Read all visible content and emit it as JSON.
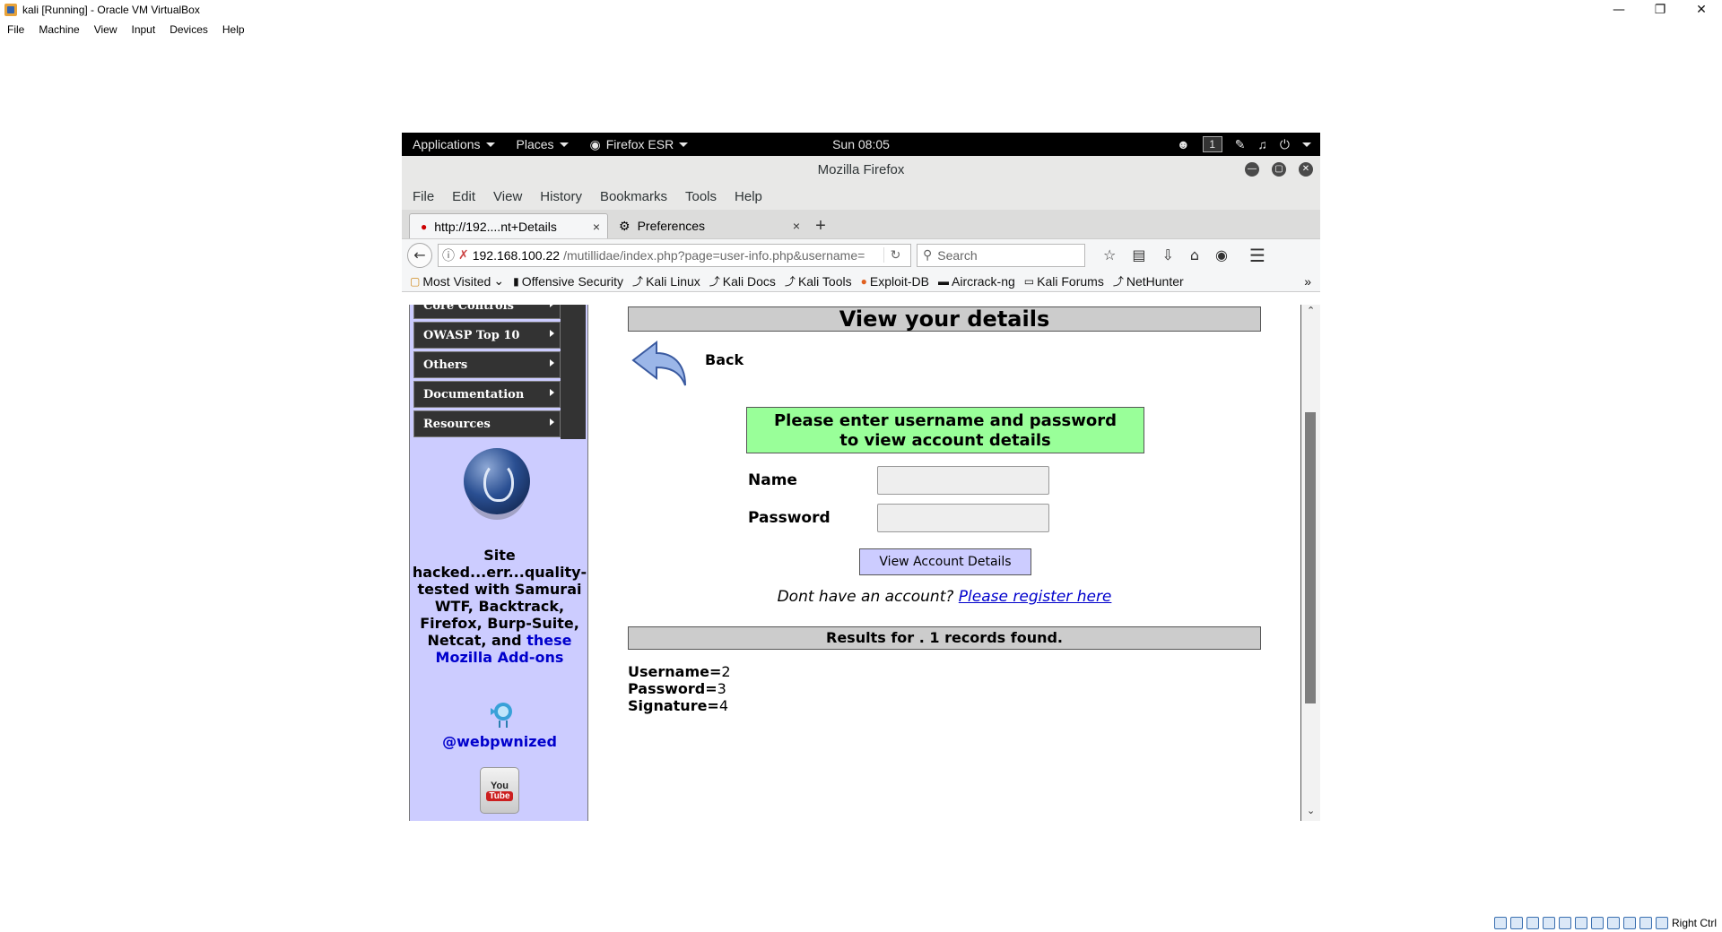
{
  "virtualbox": {
    "title": "kali [Running] - Oracle VM VirtualBox",
    "menu": [
      "File",
      "Machine",
      "View",
      "Input",
      "Devices",
      "Help"
    ],
    "host_key": "Right Ctrl"
  },
  "gnome": {
    "applications": "Applications",
    "places": "Places",
    "firefox": "Firefox ESR",
    "clock": "Sun 08:05",
    "workspace": "1"
  },
  "firefox": {
    "window_title": "Mozilla Firefox",
    "menu": [
      "File",
      "Edit",
      "View",
      "History",
      "Bookmarks",
      "Tools",
      "Help"
    ],
    "tabs": [
      {
        "label": "http://192....nt+Details",
        "close": "×"
      },
      {
        "label": "Preferences",
        "close": "×"
      }
    ],
    "new_tab": "+",
    "url_host": "192.168.100.22",
    "url_path": "/mutillidae/index.php?page=user-info.php&username=",
    "search_placeholder": "Search",
    "bookmarks": [
      "Most Visited",
      "Offensive Security",
      "Kali Linux",
      "Kali Docs",
      "Kali Tools",
      "Exploit-DB",
      "Aircrack-ng",
      "Kali Forums",
      "NetHunter"
    ],
    "bookmarks_more": "»"
  },
  "sidebar": {
    "menu_items": [
      "Core Controls",
      "OWASP Top 10",
      "Others",
      "Documentation",
      "Resources"
    ],
    "site_text_a": "Site hacked...err...quality-tested with Samurai WTF, Backtrack, Firefox, Burp-Suite, Netcat, and",
    "site_text_link": "these Mozilla Add-ons",
    "twitter_handle": "@webpwnized",
    "youtube_you": "You",
    "youtube_tube": "Tube"
  },
  "page": {
    "heading": "View your details",
    "back": "Back",
    "instruction_line1": "Please enter username and password",
    "instruction_line2": "to view account details",
    "name_label": "Name",
    "password_label": "Password",
    "submit": "View Account Details",
    "register_prefix": "Dont have an account?",
    "register_link": "Please register here",
    "results": "Results for . 1 records found.",
    "records": [
      {
        "label": "Username=",
        "value": "2"
      },
      {
        "label": "Password=",
        "value": "3"
      },
      {
        "label": "Signature=",
        "value": "4"
      }
    ]
  }
}
